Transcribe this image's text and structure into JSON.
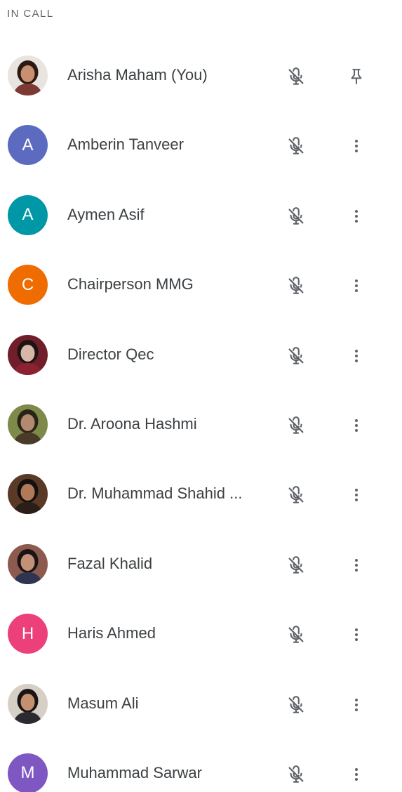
{
  "panel": {
    "section_title": "IN CALL"
  },
  "participants": [
    {
      "name": "Arisha Maham (You)",
      "avatar_type": "photo",
      "avatar_colors": {
        "bg": "#e9e4df",
        "hair": "#2b1a12",
        "skin": "#c98f72",
        "shirt": "#7c3a32"
      },
      "mic": "mic-off-icon",
      "action": "pin-icon"
    },
    {
      "name": "Amberin Tanveer",
      "avatar_type": "initial",
      "initial": "A",
      "color": "#5c6bc0",
      "mic": "mic-off-icon",
      "action": "more-vert-icon"
    },
    {
      "name": "Aymen Asif",
      "avatar_type": "initial",
      "initial": "A",
      "color": "#0097a7",
      "mic": "mic-off-icon",
      "action": "more-vert-icon"
    },
    {
      "name": "Chairperson MMG",
      "avatar_type": "initial",
      "initial": "C",
      "color": "#ef6c00",
      "mic": "mic-off-icon",
      "action": "more-vert-icon"
    },
    {
      "name": "Director Qec",
      "avatar_type": "photo",
      "avatar_colors": {
        "bg": "#6f1e2a",
        "hair": "#1c1414",
        "skin": "#d7b5a7",
        "shirt": "#8b2232"
      },
      "mic": "mic-off-icon",
      "action": "more-vert-icon"
    },
    {
      "name": "Dr. Aroona Hashmi",
      "avatar_type": "photo",
      "avatar_colors": {
        "bg": "#7d8a4a",
        "hair": "#2a2418",
        "skin": "#b48a6e",
        "shirt": "#4a3a2a"
      },
      "mic": "mic-off-icon",
      "action": "more-vert-icon"
    },
    {
      "name": "Dr. Muhammad Shahid ...",
      "avatar_type": "photo",
      "avatar_colors": {
        "bg": "#5a3a26",
        "hair": "#141010",
        "skin": "#b07a58",
        "shirt": "#2a1e18"
      },
      "mic": "mic-off-icon",
      "action": "more-vert-icon"
    },
    {
      "name": "Fazal Khalid",
      "avatar_type": "photo",
      "avatar_colors": {
        "bg": "#8c5a4e",
        "hair": "#1a1414",
        "skin": "#c49078",
        "shirt": "#2d3550"
      },
      "mic": "mic-off-icon",
      "action": "more-vert-icon"
    },
    {
      "name": "Haris Ahmed",
      "avatar_type": "initial",
      "initial": "H",
      "color": "#ec407a",
      "mic": "mic-off-icon",
      "action": "more-vert-icon"
    },
    {
      "name": "Masum Ali",
      "avatar_type": "photo",
      "avatar_colors": {
        "bg": "#d6cfc6",
        "hair": "#1a1414",
        "skin": "#c49070",
        "shirt": "#2a2a30"
      },
      "mic": "mic-off-icon",
      "action": "more-vert-icon"
    },
    {
      "name": "Muhammad Sarwar",
      "avatar_type": "initial",
      "initial": "M",
      "color": "#7e57c2",
      "mic": "mic-off-icon",
      "action": "more-vert-icon"
    }
  ],
  "colors": {
    "icon": "#5f6368",
    "text": "#3c4043",
    "header": "#5f6368"
  }
}
